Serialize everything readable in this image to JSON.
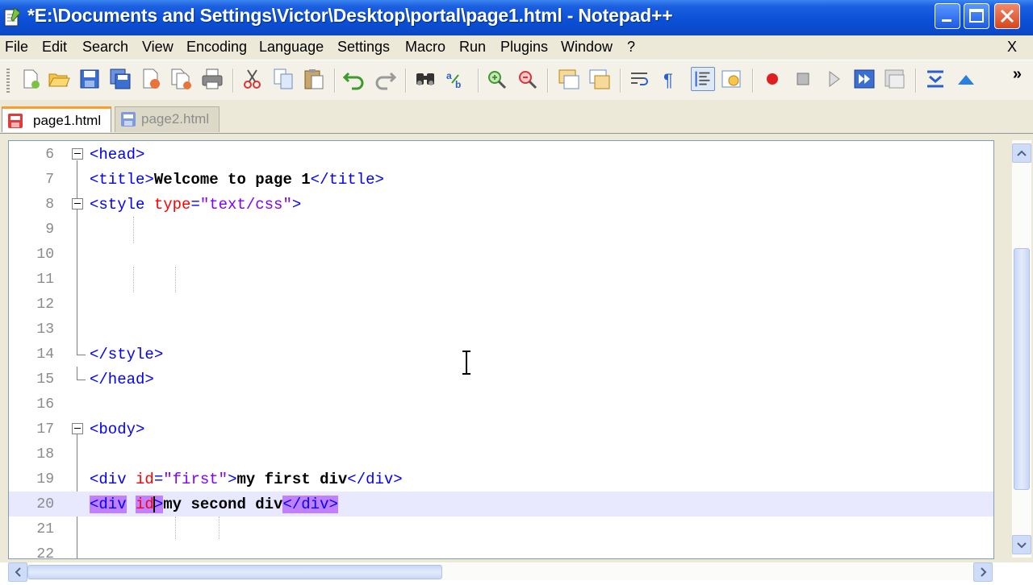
{
  "window": {
    "title": "*E:\\Documents and Settings\\Victor\\Desktop\\portal\\page1.html - Notepad++"
  },
  "menu": {
    "items": [
      "File",
      "Edit",
      "Search",
      "View",
      "Encoding",
      "Language",
      "Settings",
      "Macro",
      "Run",
      "Plugins",
      "Window",
      "?"
    ],
    "close_label": "X"
  },
  "toolbar": {
    "buttons": [
      "new-file-icon",
      "open-file-icon",
      "save-icon",
      "save-all-icon",
      "close-icon",
      "close-all-icon",
      "print-icon",
      "cut-icon",
      "copy-icon",
      "paste-icon",
      "undo-icon",
      "redo-icon",
      "find-icon",
      "replace-icon",
      "zoom-in-icon",
      "zoom-out-icon",
      "sync-vertical-icon",
      "sync-horizontal-icon",
      "word-wrap-icon",
      "show-all-chars-icon",
      "indent-guide-icon",
      "user-lang-icon",
      "record-macro-icon",
      "stop-macro-icon",
      "play-macro-icon",
      "run-macro-multiple-icon",
      "save-macro-icon",
      "collapse-icon",
      "expand-icon"
    ],
    "more_label": "»"
  },
  "tabs": [
    {
      "label": "page1.html",
      "active": true
    },
    {
      "label": "page2.html",
      "active": false
    }
  ],
  "editor": {
    "lines": [
      {
        "num": "6"
      },
      {
        "num": "7"
      },
      {
        "num": "8"
      },
      {
        "num": "9"
      },
      {
        "num": "10"
      },
      {
        "num": "11"
      },
      {
        "num": "12"
      },
      {
        "num": "13"
      },
      {
        "num": "14"
      },
      {
        "num": "15"
      },
      {
        "num": "16"
      },
      {
        "num": "17"
      },
      {
        "num": "18"
      },
      {
        "num": "19"
      },
      {
        "num": "20"
      },
      {
        "num": "21"
      },
      {
        "num": "22"
      }
    ],
    "tokens": {
      "l6_tag": "<head>",
      "l7_open": "<title>",
      "l7_text": "Welcome to page 1",
      "l7_close": "</title>",
      "l8_tag": "<style ",
      "l8_attr": "type",
      "l8_eq": "=",
      "l8_val": "\"text/css\"",
      "l8_end": ">",
      "l14_tag": "</style>",
      "l15_tag": "</head>",
      "l17_tag": "<body>",
      "l19_tag": "<div ",
      "l19_attr": "id",
      "l19_eq": "=",
      "l19_val": "\"first\"",
      "l19_gt": ">",
      "l19_text": "my first div",
      "l19_close": "</div>",
      "l20_tag": "<div",
      "l20_sp": " ",
      "l20_attr": "id",
      "l20_gt": ">",
      "l20_text": "my second div",
      "l20_close": "</div>"
    }
  },
  "colors": {
    "tag": "#0000ff",
    "attribute": "#ff0000",
    "value": "#8000ff",
    "highlight": "#c080ff",
    "current_line": "#e8e8ff",
    "titlebar": "#0a4fd6"
  }
}
